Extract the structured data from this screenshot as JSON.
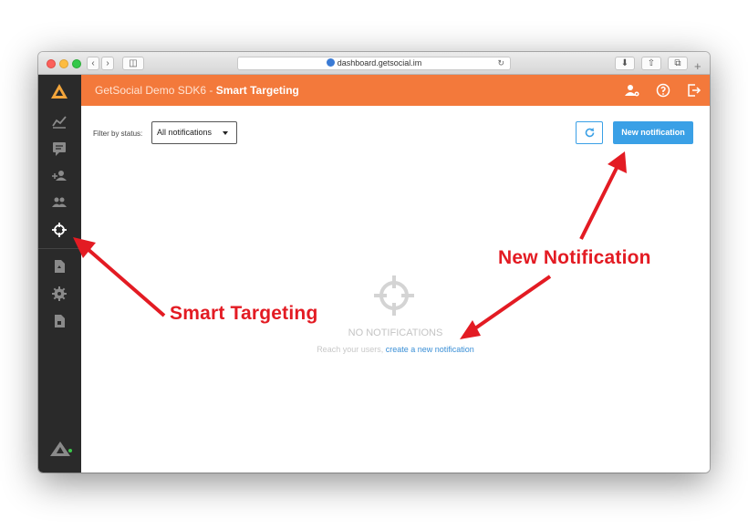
{
  "browser": {
    "url": "dashboard.getsocial.im"
  },
  "header": {
    "app_name": "GetSocial Demo SDK6 -",
    "page_title": "Smart Targeting"
  },
  "toolbar": {
    "filter_label": "Filter by status:",
    "filter_value": "All notifications",
    "new_button": "New notification"
  },
  "empty_state": {
    "title": "NO NOTIFICATIONS",
    "subtitle": "Reach your users,",
    "link": "create a new notification"
  },
  "annotations": {
    "new_notification": "New Notification",
    "smart_targeting": "Smart Targeting"
  },
  "colors": {
    "accent": "#f3793b",
    "primary_button": "#3aa0e6",
    "sidebar": "#2a2a2a",
    "annotation": "#e31b23"
  }
}
